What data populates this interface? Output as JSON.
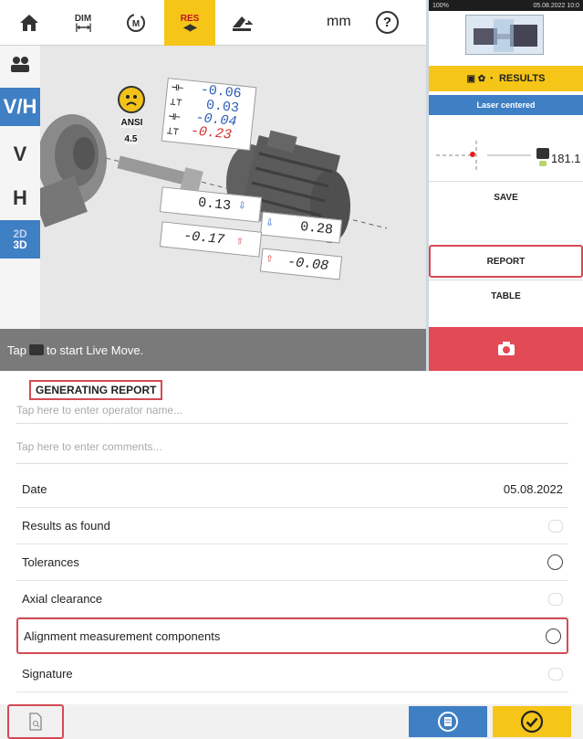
{
  "toolbar": {
    "items": [
      {
        "name": "home-icon"
      },
      {
        "label": "DIM"
      },
      {
        "label": "M"
      },
      {
        "label": "RES"
      },
      {
        "name": "machine-move-icon"
      }
    ],
    "unit": "mm",
    "help": "?"
  },
  "sidebar": {
    "items": [
      "V/H",
      "V",
      "H"
    ],
    "mode": {
      "top": "2D",
      "bottom": "3D"
    }
  },
  "view": {
    "tolerance": "ANSI 4.5",
    "coupling_values": {
      "gap_vertical": "-0.06",
      "offset_vertical": "0.03",
      "gap_horizontal": "-0.04",
      "offset_horizontal": "-0.23"
    },
    "feet_values": {
      "front_vertical": "0.13",
      "front_horizontal": "-0.17",
      "back_vertical": "0.28",
      "back_horizontal": "-0.08"
    }
  },
  "hint": {
    "before": "Tap",
    "after": "to start Live Move."
  },
  "right_panel": {
    "status_left": "100%",
    "status_right": "05.08.2022 10:0",
    "results_label": "RESULTS",
    "laser_status": "Laser centered",
    "sensor_value": "181.1",
    "buttons": [
      "SAVE",
      "REPORT",
      "TABLE"
    ]
  },
  "form": {
    "title": "GENERATING REPORT",
    "operator_placeholder": "Tap here to enter operator name...",
    "comments_placeholder": "Tap here to enter comments...",
    "rows": [
      {
        "label": "Date",
        "value": "05.08.2022"
      },
      {
        "label": "Results as found"
      },
      {
        "label": "Tolerances"
      },
      {
        "label": "Axial clearance"
      },
      {
        "label": "Alignment measurement components"
      },
      {
        "label": "Signature"
      }
    ]
  },
  "colors": {
    "accent_yellow": "#f5c518",
    "accent_blue": "#3f7fc4",
    "alert_red": "#e24a55",
    "highlight_red": "#d34a55"
  }
}
